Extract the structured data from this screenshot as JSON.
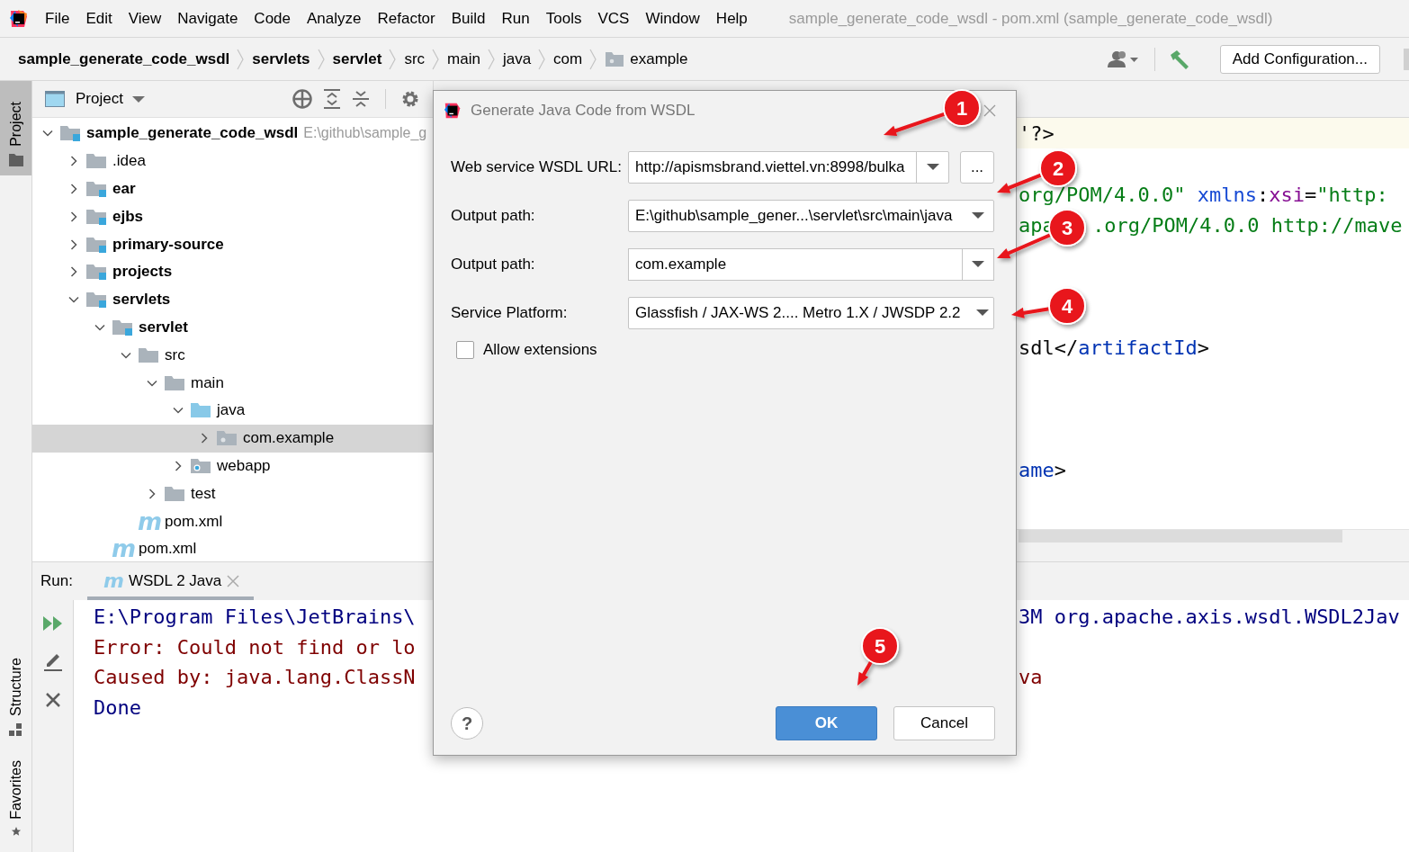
{
  "window": {
    "title": "sample_generate_code_wsdl - pom.xml (sample_generate_code_wsdl)"
  },
  "menu": [
    "File",
    "Edit",
    "View",
    "Navigate",
    "Code",
    "Analyze",
    "Refactor",
    "Build",
    "Run",
    "Tools",
    "VCS",
    "Window",
    "Help"
  ],
  "breadcrumbs": [
    {
      "label": "sample_generate_code_wsdl",
      "kind": "module"
    },
    {
      "label": "servlets",
      "kind": "module"
    },
    {
      "label": "servlet",
      "kind": "module"
    },
    {
      "label": "src",
      "kind": "folder"
    },
    {
      "label": "main",
      "kind": "folder"
    },
    {
      "label": "java",
      "kind": "folder"
    },
    {
      "label": "com",
      "kind": "folder"
    },
    {
      "label": "example",
      "kind": "package"
    }
  ],
  "toolbar": {
    "run_config": "Add Configuration..."
  },
  "side_tabs": [
    {
      "label": "Project",
      "selected": true,
      "kind": "project"
    },
    {
      "label": "Structure",
      "selected": false,
      "kind": "structure"
    },
    {
      "label": "Favorites",
      "selected": false,
      "kind": "favorites"
    }
  ],
  "project": {
    "title": "Project",
    "tree": [
      {
        "label": "sample_generate_code_wsdl",
        "path": "E:\\github\\sample_g",
        "kind": "module",
        "expanded": true,
        "selected": false,
        "children": [
          {
            "label": ".idea",
            "kind": "folder",
            "expanded": false,
            "selected": false
          },
          {
            "label": "ear",
            "kind": "module",
            "expanded": false,
            "selected": false
          },
          {
            "label": "ejbs",
            "kind": "module",
            "expanded": false,
            "selected": false
          },
          {
            "label": "primary-source",
            "kind": "module",
            "expanded": false,
            "selected": false
          },
          {
            "label": "projects",
            "kind": "module",
            "expanded": false,
            "selected": false
          },
          {
            "label": "servlets",
            "kind": "module",
            "expanded": true,
            "selected": false,
            "children": [
              {
                "label": "servlet",
                "kind": "module",
                "expanded": true,
                "selected": false,
                "children": [
                  {
                    "label": "src",
                    "kind": "folder",
                    "expanded": true,
                    "selected": false,
                    "children": [
                      {
                        "label": "main",
                        "kind": "folder",
                        "expanded": true,
                        "selected": false,
                        "children": [
                          {
                            "label": "java",
                            "kind": "source",
                            "expanded": true,
                            "selected": false,
                            "children": [
                              {
                                "label": "com.example",
                                "kind": "package",
                                "expanded": false,
                                "selected": true
                              }
                            ]
                          },
                          {
                            "label": "webapp",
                            "kind": "webapp",
                            "expanded": false,
                            "selected": false
                          }
                        ]
                      },
                      {
                        "label": "test",
                        "kind": "folder",
                        "expanded": false,
                        "selected": false
                      }
                    ]
                  },
                  {
                    "label": "pom.xml",
                    "kind": "maven",
                    "icon_text": "m",
                    "selected": false
                  }
                ]
              },
              {
                "label": "pom.xml",
                "kind": "maven",
                "icon_text": "m",
                "selected": false
              }
            ]
          }
        ]
      }
    ]
  },
  "editor": {
    "lines": [
      {
        "current": true,
        "segments": [
          {
            "kind": "plain",
            "text": "'?>"
          }
        ]
      },
      {
        "current": false,
        "segments": [
          {
            "kind": "string",
            "text": "org/POM/4.0.0\" "
          },
          {
            "kind": "attribute",
            "text": "xmlns"
          },
          {
            "kind": "plain",
            "text": ":"
          },
          {
            "kind": "namespace",
            "text": "xsi"
          },
          {
            "kind": "plain",
            "text": "="
          },
          {
            "kind": "string",
            "text": "\"http:"
          }
        ]
      },
      {
        "current": false,
        "segments": [
          {
            "kind": "string",
            "text": "apa"
          },
          {
            "kind": "string",
            "text": ".org/POM/4.0.0 http://mave",
            "gap_before": true
          }
        ]
      },
      {
        "current": false,
        "segments": [
          {
            "kind": "plain",
            "text": "sdl</"
          },
          {
            "kind": "tag",
            "text": "artifactId"
          },
          {
            "kind": "plain",
            "text": ">"
          }
        ]
      },
      {
        "current": false,
        "segments": [
          {
            "kind": "tag",
            "text": "ame"
          },
          {
            "kind": "plain",
            "text": ">"
          }
        ]
      }
    ]
  },
  "run": {
    "label": "Run:",
    "tab": {
      "label": "WSDL 2 Java",
      "icon_text": "m"
    },
    "console": [
      {
        "kind": "command",
        "left": "E:\\Program Files\\JetBrains\\",
        "right": "3M org.apache.axis.wsdl.WSDL2Jav"
      },
      {
        "kind": "error",
        "left": "Error: Could not find or lo"
      },
      {
        "kind": "error",
        "left": "Caused by: java.lang.ClassN",
        "right": "va"
      },
      {
        "kind": "info",
        "left": "Done"
      }
    ]
  },
  "dialog": {
    "title": "Generate Java Code from WSDL",
    "fields": [
      {
        "label": "Web service WSDL URL:",
        "value": "http://apismsbrand.viettel.vn:8998/bulka",
        "kind": "combo-browse",
        "browse": "..."
      },
      {
        "label": "Output path:",
        "value": "E:\\github\\sample_gener...\\servlet\\src\\main\\java",
        "kind": "combo"
      },
      {
        "label": "Output path:",
        "value": "com.example",
        "kind": "text-dropdown"
      },
      {
        "label": "Service Platform:",
        "value": "Glassfish / JAX-WS 2.... Metro 1.X / JWSDP 2.2",
        "kind": "select"
      }
    ],
    "allow_extensions": {
      "label": "Allow extensions",
      "checked": false
    },
    "help": "?",
    "buttons": [
      {
        "label": "OK",
        "kind": "primary"
      },
      {
        "label": "Cancel",
        "kind": "secondary"
      }
    ]
  },
  "callouts": [
    "1",
    "2",
    "3",
    "4",
    "5"
  ]
}
